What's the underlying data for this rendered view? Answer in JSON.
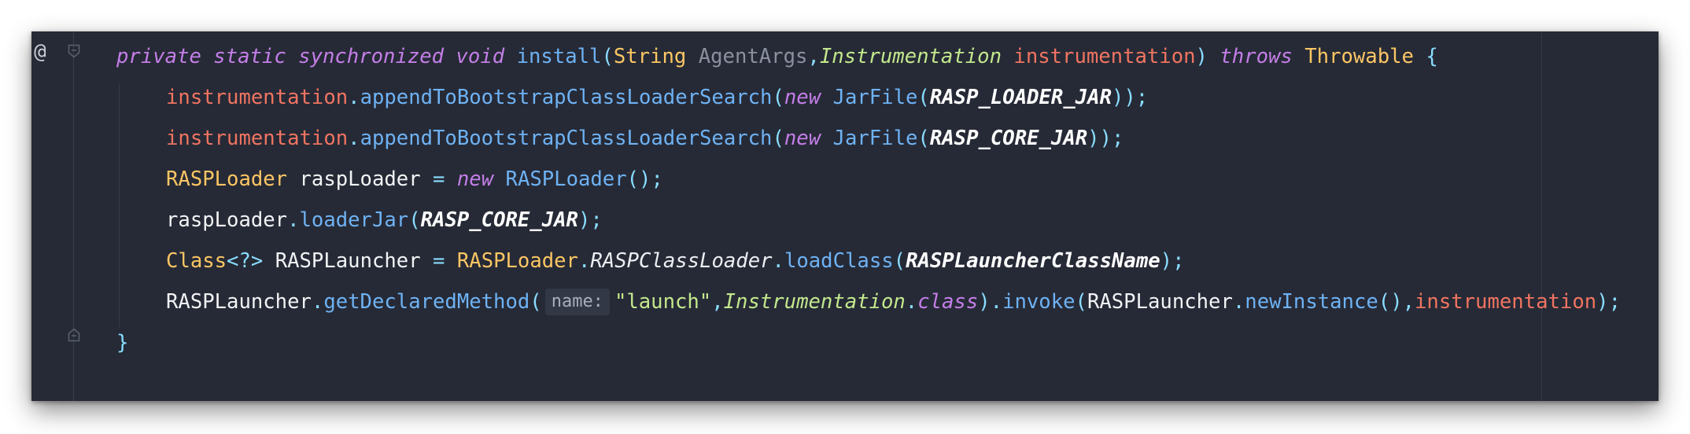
{
  "gutter": {
    "annotation_marker": "@"
  },
  "code": {
    "lines": [
      {
        "tokens": [
          {
            "t": "private",
            "c": "kw"
          },
          {
            "t": " ",
            "c": ""
          },
          {
            "t": "static",
            "c": "kw"
          },
          {
            "t": " ",
            "c": ""
          },
          {
            "t": "synchronized",
            "c": "kw"
          },
          {
            "t": " ",
            "c": ""
          },
          {
            "t": "void",
            "c": "kw"
          },
          {
            "t": " ",
            "c": ""
          },
          {
            "t": "install",
            "c": "meth"
          },
          {
            "t": "(",
            "c": "punc"
          },
          {
            "t": "String",
            "c": "type"
          },
          {
            "t": " ",
            "c": ""
          },
          {
            "t": "AgentArgs",
            "c": "param"
          },
          {
            "t": ",",
            "c": "punc"
          },
          {
            "t": "Instrumentation",
            "c": "typei"
          },
          {
            "t": " ",
            "c": ""
          },
          {
            "t": "instrumentation",
            "c": "var"
          },
          {
            "t": ")",
            "c": "punc"
          },
          {
            "t": " ",
            "c": ""
          },
          {
            "t": "throws",
            "c": "kw"
          },
          {
            "t": " ",
            "c": ""
          },
          {
            "t": "Throwable",
            "c": "type"
          },
          {
            "t": " ",
            "c": ""
          },
          {
            "t": "{",
            "c": "punc"
          }
        ]
      },
      {
        "indent": true,
        "tokens": [
          {
            "t": "instrumentation",
            "c": "var"
          },
          {
            "t": ".",
            "c": "punc"
          },
          {
            "t": "appendToBootstrapClassLoaderSearch",
            "c": "meth"
          },
          {
            "t": "(",
            "c": "punc"
          },
          {
            "t": "new",
            "c": "kw"
          },
          {
            "t": " ",
            "c": ""
          },
          {
            "t": "JarFile",
            "c": "meth"
          },
          {
            "t": "(",
            "c": "punc"
          },
          {
            "t": "RASP_LOADER_JAR",
            "c": "const"
          },
          {
            "t": "));",
            "c": "punc"
          }
        ]
      },
      {
        "indent": true,
        "tokens": [
          {
            "t": "instrumentation",
            "c": "var"
          },
          {
            "t": ".",
            "c": "punc"
          },
          {
            "t": "appendToBootstrapClassLoaderSearch",
            "c": "meth"
          },
          {
            "t": "(",
            "c": "punc"
          },
          {
            "t": "new",
            "c": "kw"
          },
          {
            "t": " ",
            "c": ""
          },
          {
            "t": "JarFile",
            "c": "meth"
          },
          {
            "t": "(",
            "c": "punc"
          },
          {
            "t": "RASP_CORE_JAR",
            "c": "const"
          },
          {
            "t": "));",
            "c": "punc"
          }
        ]
      },
      {
        "indent": true,
        "tokens": [
          {
            "t": "RASPLoader",
            "c": "type"
          },
          {
            "t": " ",
            "c": ""
          },
          {
            "t": "raspLoader",
            "c": "local"
          },
          {
            "t": " ",
            "c": ""
          },
          {
            "t": "=",
            "c": "punc"
          },
          {
            "t": " ",
            "c": ""
          },
          {
            "t": "new",
            "c": "kw"
          },
          {
            "t": " ",
            "c": ""
          },
          {
            "t": "RASPLoader",
            "c": "meth"
          },
          {
            "t": "();",
            "c": "punc"
          }
        ]
      },
      {
        "indent": true,
        "tokens": [
          {
            "t": "raspLoader",
            "c": "local"
          },
          {
            "t": ".",
            "c": "punc"
          },
          {
            "t": "loaderJar",
            "c": "meth"
          },
          {
            "t": "(",
            "c": "punc"
          },
          {
            "t": "RASP_CORE_JAR",
            "c": "const"
          },
          {
            "t": ");",
            "c": "punc"
          }
        ]
      },
      {
        "indent": true,
        "tokens": [
          {
            "t": "Class",
            "c": "type"
          },
          {
            "t": "<?>",
            "c": "punc"
          },
          {
            "t": " ",
            "c": ""
          },
          {
            "t": "RASPLauncher",
            "c": "local"
          },
          {
            "t": " ",
            "c": ""
          },
          {
            "t": "=",
            "c": "punc"
          },
          {
            "t": " ",
            "c": ""
          },
          {
            "t": "RASPLoader",
            "c": "type"
          },
          {
            "t": ".",
            "c": "punc"
          },
          {
            "t": "RASPClassLoader",
            "c": "stat"
          },
          {
            "t": ".",
            "c": "punc"
          },
          {
            "t": "loadClass",
            "c": "meth"
          },
          {
            "t": "(",
            "c": "punc"
          },
          {
            "t": "RASPLauncherClassName",
            "c": "const"
          },
          {
            "t": ");",
            "c": "punc"
          }
        ]
      },
      {
        "indent": true,
        "tokens": [
          {
            "t": "RASPLauncher",
            "c": "local"
          },
          {
            "t": ".",
            "c": "punc"
          },
          {
            "t": "getDeclaredMethod",
            "c": "meth"
          },
          {
            "t": "(",
            "c": "punc"
          },
          {
            "t": "name:",
            "c": "hint"
          },
          {
            "t": "\"launch\"",
            "c": "str"
          },
          {
            "t": ",",
            "c": "punc"
          },
          {
            "t": "Instrumentation",
            "c": "typei"
          },
          {
            "t": ".",
            "c": "punc"
          },
          {
            "t": "class",
            "c": "kw"
          },
          {
            "t": ").",
            "c": "punc"
          },
          {
            "t": "invoke",
            "c": "meth"
          },
          {
            "t": "(",
            "c": "punc"
          },
          {
            "t": "RASPLauncher",
            "c": "local"
          },
          {
            "t": ".",
            "c": "punc"
          },
          {
            "t": "newInstance",
            "c": "meth"
          },
          {
            "t": "(),",
            "c": "punc"
          },
          {
            "t": "instrumentation",
            "c": "var"
          },
          {
            "t": ");",
            "c": "punc"
          }
        ]
      },
      {
        "tokens": [
          {
            "t": "}",
            "c": "punc"
          }
        ]
      }
    ]
  }
}
